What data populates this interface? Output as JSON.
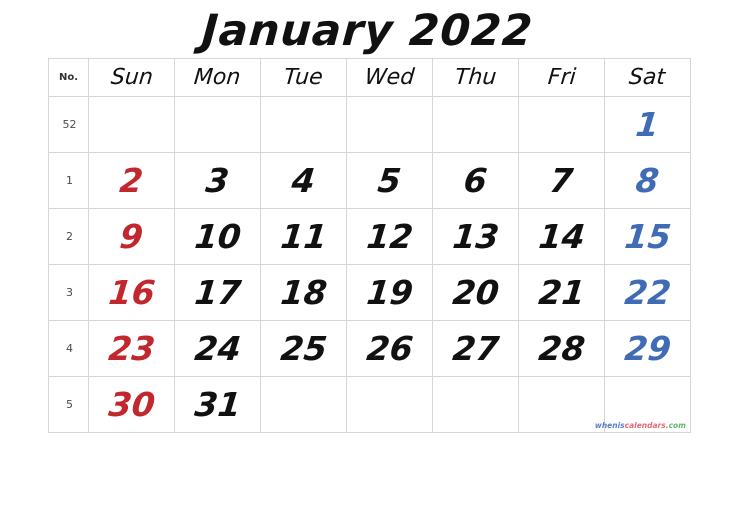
{
  "title": "January 2022",
  "colors": {
    "sunday": "#c1272d",
    "saturday": "#3f6cb5",
    "weekday": "#111111",
    "grid_border": "#d6d6d6",
    "background": "#ffffff"
  },
  "table": {
    "week_number_header": "No.",
    "day_headers": [
      "Sun",
      "Mon",
      "Tue",
      "Wed",
      "Thu",
      "Fri",
      "Sat"
    ],
    "rows": [
      {
        "week": "52",
        "days": [
          "",
          "",
          "",
          "",
          "",
          "",
          "1"
        ]
      },
      {
        "week": "1",
        "days": [
          "2",
          "3",
          "4",
          "5",
          "6",
          "7",
          "8"
        ]
      },
      {
        "week": "2",
        "days": [
          "9",
          "10",
          "11",
          "12",
          "13",
          "14",
          "15"
        ]
      },
      {
        "week": "3",
        "days": [
          "16",
          "17",
          "18",
          "19",
          "20",
          "21",
          "22"
        ]
      },
      {
        "week": "4",
        "days": [
          "23",
          "24",
          "25",
          "26",
          "27",
          "28",
          "29"
        ]
      },
      {
        "week": "5",
        "days": [
          "30",
          "31",
          "",
          "",
          "",
          "",
          ""
        ]
      }
    ]
  },
  "watermark": {
    "part1": "whenis",
    "part2": "calendars",
    "part3": ".com"
  }
}
